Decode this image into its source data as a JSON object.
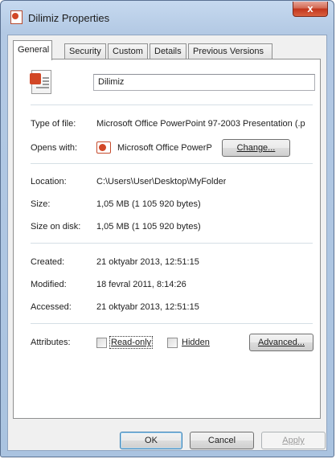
{
  "window": {
    "title": "Dilimiz Properties",
    "close_label": "x"
  },
  "tabs": [
    {
      "label": "General",
      "active": true
    },
    {
      "label": "Security"
    },
    {
      "label": "Custom"
    },
    {
      "label": "Details"
    },
    {
      "label": "Previous Versions"
    }
  ],
  "file": {
    "name": "Dilimiz",
    "icon": "powerpoint-file-icon"
  },
  "type_of_file": {
    "label": "Type of file:",
    "value": "Microsoft Office PowerPoint 97-2003 Presentation (.p"
  },
  "opens_with": {
    "label": "Opens with:",
    "value": "Microsoft Office PowerP",
    "icon": "powerpoint-app-icon",
    "button": "Change..."
  },
  "location": {
    "label": "Location:",
    "value": "C:\\Users\\User\\Desktop\\MyFolder"
  },
  "size": {
    "label": "Size:",
    "value": "1,05 MB (1 105 920 bytes)"
  },
  "size_on_disk": {
    "label": "Size on disk:",
    "value": "1,05 MB (1 105 920 bytes)"
  },
  "created": {
    "label": "Created:",
    "value": "21 oktyabr 2013, 12:51:15"
  },
  "modified": {
    "label": "Modified:",
    "value": "18 fevral 2011, 8:14:26"
  },
  "accessed": {
    "label": "Accessed:",
    "value": "21 oktyabr 2013, 12:51:15"
  },
  "attributes": {
    "label": "Attributes:",
    "readonly_label": "Read-only",
    "readonly_checked": false,
    "hidden_label": "Hidden",
    "hidden_checked": false,
    "advanced_label": "Advanced..."
  },
  "footer": {
    "ok": "OK",
    "cancel": "Cancel",
    "apply": "Apply"
  }
}
